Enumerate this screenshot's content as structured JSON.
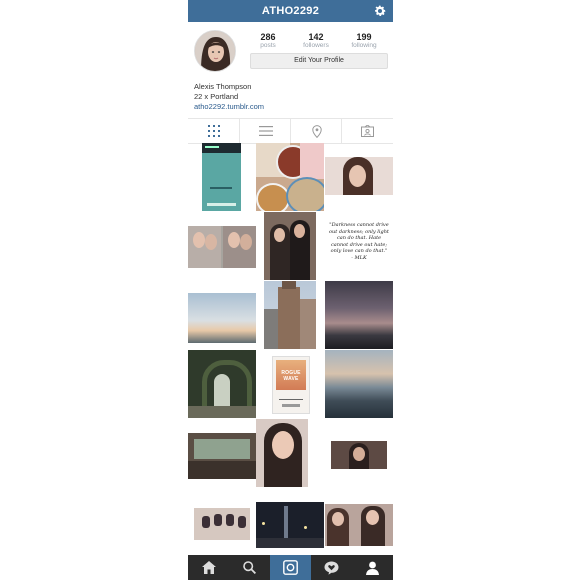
{
  "header": {
    "username": "ATHO2292",
    "settings_icon": "gear-icon"
  },
  "profile": {
    "stats": [
      {
        "value": "286",
        "label": "posts"
      },
      {
        "value": "142",
        "label": "followers"
      },
      {
        "value": "199",
        "label": "following"
      }
    ],
    "edit_button": "Edit Your Profile",
    "name": "Alexis Thompson",
    "bio": "22 x Portland",
    "link": "atho2292.tumblr.com"
  },
  "tabs": [
    "grid-icon",
    "list-icon",
    "location-pin-icon",
    "tagged-photos-icon"
  ],
  "posts": {
    "quote_text": "\"Darkness cannot drive out darkness; only light can do that. Hate cannot drive out hate; only love can do that.\"",
    "quote_author": "- MLK",
    "album_title": "ROGUE WAVE"
  },
  "bottom_nav": [
    "home-icon",
    "search-icon",
    "camera-icon",
    "activity-icon",
    "profile-icon"
  ],
  "colors": {
    "brand": "#3f6e99",
    "navbar": "#2b2b2b",
    "link": "#2a5a8c"
  }
}
